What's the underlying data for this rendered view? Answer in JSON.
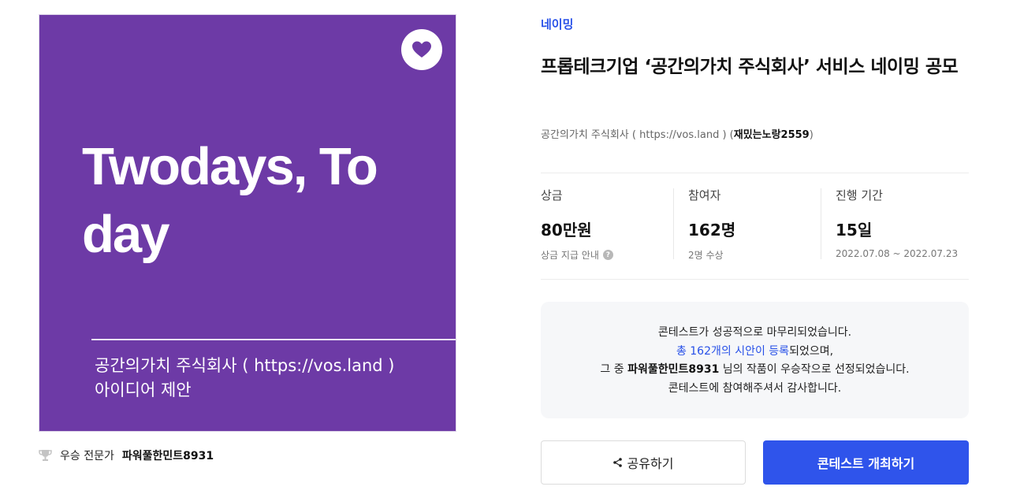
{
  "thumbnail": {
    "title_line1": "Twodays, To",
    "title_line2": "day",
    "subtitle_line1": "공간의가치 주식회사 ( https://vos.land )",
    "subtitle_line2": "아이디어 제안",
    "background": "#6d3aa6"
  },
  "favorite": {
    "icon": "heart-icon",
    "color": "#6d3aa6"
  },
  "winner": {
    "icon": "trophy-icon",
    "label": "우승 전문가",
    "name": "파워풀한민트8931"
  },
  "category": "네이밍",
  "title": "프롭테크기업 ‘공간의가치 주식회사’ 서비스 네이밍 공모",
  "host": {
    "text": "공간의가치 주식회사 ( https://vos.land ) (",
    "nickname": "재밌는노랑2559",
    "close": ")"
  },
  "stats": {
    "prize": {
      "label": "상금",
      "value": "80만원",
      "sub": "상금 지급 안내",
      "help_icon": "?"
    },
    "participants": {
      "label": "참여자",
      "value": "162명",
      "sub": "2명 수상"
    },
    "period": {
      "label": "진행 기간",
      "value": "15일",
      "sub": "2022.07.08 ~ 2022.07.23"
    }
  },
  "notice": {
    "line1": "콘테스트가 성공적으로 마무리되었습니다.",
    "line2_link": "총 162개의 시안이 등록",
    "line2_rest": "되었으며,",
    "line3_prefix": "그 중 ",
    "line3_name": "파워풀한민트8931",
    "line3_suffix": " 님의 작품이 우승작으로 선정되었습니다.",
    "line4": "콘테스트에 참여해주셔서 감사합니다."
  },
  "buttons": {
    "share_label": "공유하기",
    "host_label": "콘테스트 개최하기",
    "accent": "#2f54eb"
  }
}
